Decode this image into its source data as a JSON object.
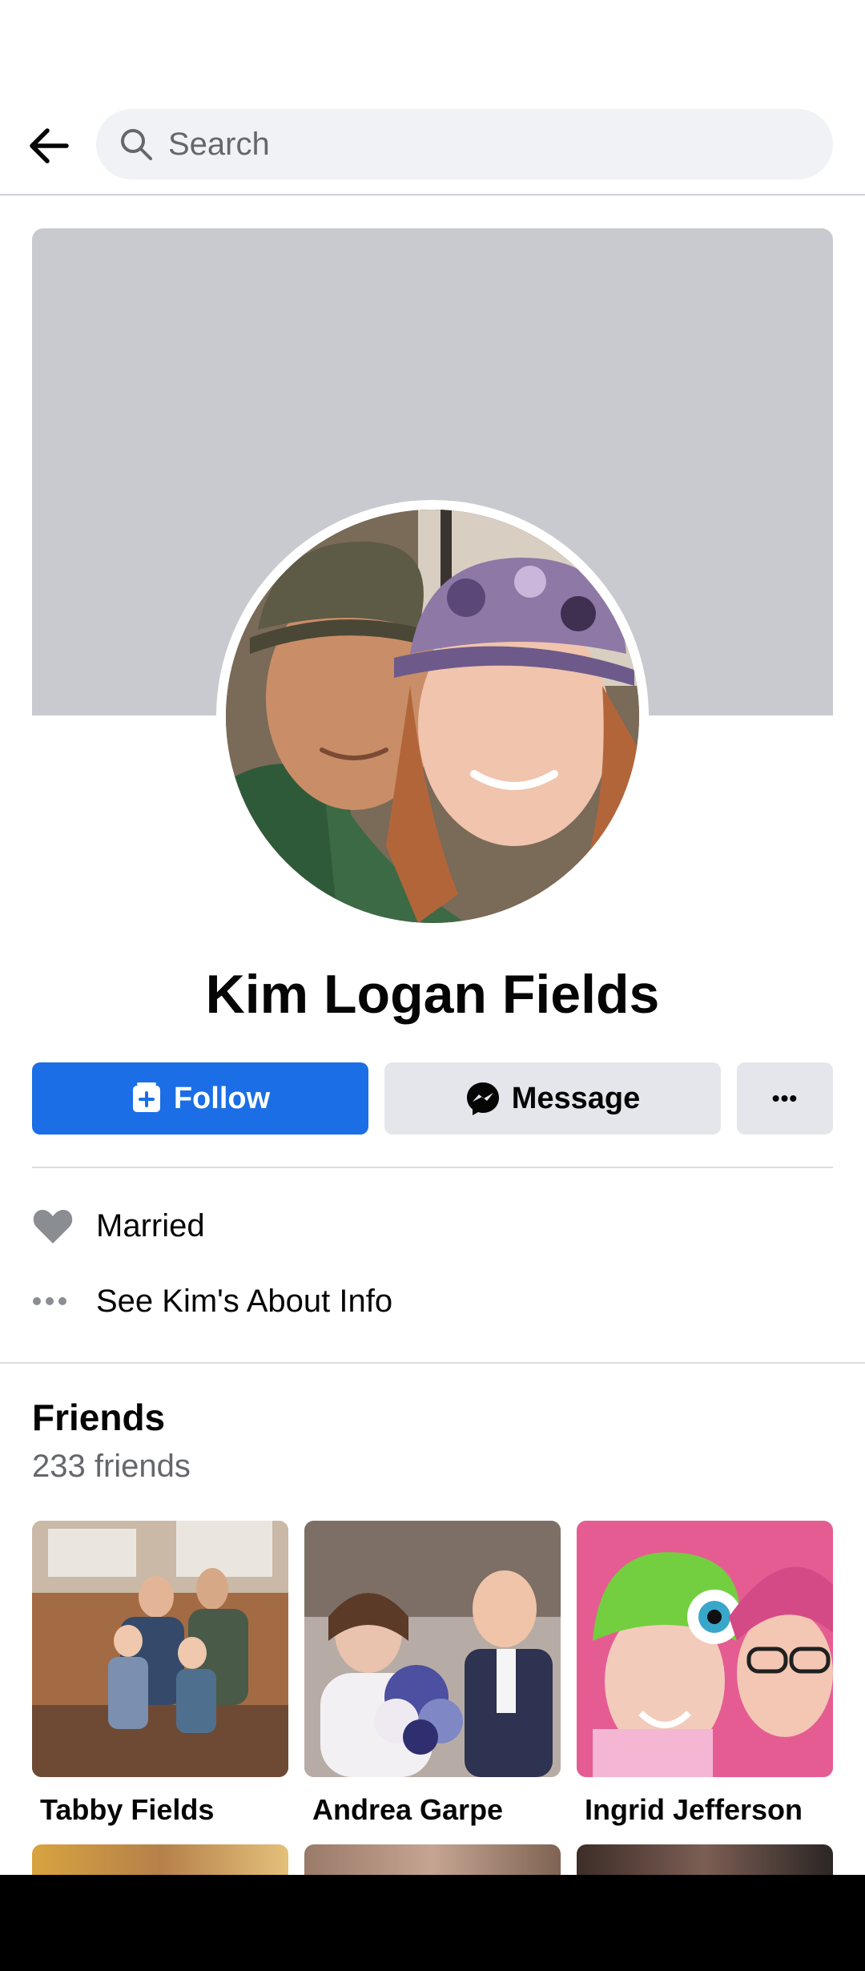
{
  "search": {
    "placeholder": "Search"
  },
  "profile": {
    "name": "Kim Logan Fields"
  },
  "actions": {
    "follow_label": "Follow",
    "message_label": "Message",
    "more_label": "•••"
  },
  "intro": {
    "relationship": "Married",
    "about_link": "See Kim's About Info"
  },
  "friends": {
    "title": "Friends",
    "count_text": "233 friends",
    "items": [
      {
        "name": "Tabby Fields"
      },
      {
        "name": "Andrea Garpe"
      },
      {
        "name": "Ingrid Jefferson"
      }
    ]
  },
  "colors": {
    "accent": "#1b6ee5",
    "secondary_button": "#e4e6eb",
    "cover_placeholder": "#c8cacf",
    "muted_text": "#65676b"
  }
}
